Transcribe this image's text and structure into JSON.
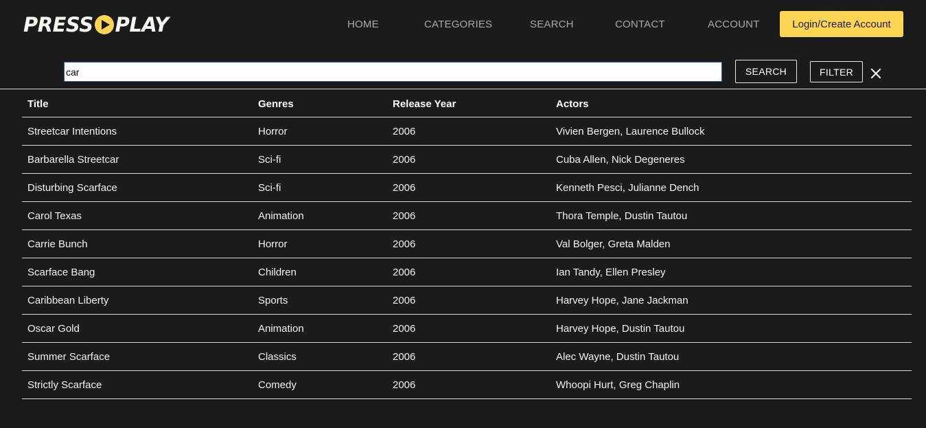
{
  "brand": {
    "left": "PRESS",
    "right": "PLAY",
    "accent": "#fbd553"
  },
  "nav": {
    "items": [
      {
        "label": "HOME"
      },
      {
        "label": "CATEGORIES"
      },
      {
        "label": "SEARCH"
      },
      {
        "label": "CONTACT"
      },
      {
        "label": "ACCOUNT"
      }
    ],
    "login_label": "Login/Create Account"
  },
  "search": {
    "value": "car",
    "search_button": "SEARCH",
    "filter_button": "FILTER",
    "clear_icon": "close-icon"
  },
  "table": {
    "headers": [
      "Title",
      "Genres",
      "Release Year",
      "Actors"
    ],
    "rows": [
      {
        "title": "Streetcar Intentions",
        "genre": "Horror",
        "year": "2006",
        "actors": "Vivien Bergen, Laurence Bullock"
      },
      {
        "title": "Barbarella Streetcar",
        "genre": "Sci-fi",
        "year": "2006",
        "actors": "Cuba Allen, Nick Degeneres"
      },
      {
        "title": "Disturbing Scarface",
        "genre": "Sci-fi",
        "year": "2006",
        "actors": "Kenneth Pesci, Julianne Dench"
      },
      {
        "title": "Carol Texas",
        "genre": "Animation",
        "year": "2006",
        "actors": "Thora Temple, Dustin Tautou"
      },
      {
        "title": "Carrie Bunch",
        "genre": "Horror",
        "year": "2006",
        "actors": "Val Bolger, Greta Malden"
      },
      {
        "title": "Scarface Bang",
        "genre": "Children",
        "year": "2006",
        "actors": "Ian Tandy, Ellen Presley"
      },
      {
        "title": "Caribbean Liberty",
        "genre": "Sports",
        "year": "2006",
        "actors": "Harvey Hope, Jane Jackman"
      },
      {
        "title": "Oscar Gold",
        "genre": "Animation",
        "year": "2006",
        "actors": "Harvey Hope, Dustin Tautou"
      },
      {
        "title": "Summer Scarface",
        "genre": "Classics",
        "year": "2006",
        "actors": "Alec Wayne, Dustin Tautou"
      },
      {
        "title": "Strictly Scarface",
        "genre": "Comedy",
        "year": "2006",
        "actors": "Whoopi Hurt, Greg Chaplin"
      }
    ]
  }
}
